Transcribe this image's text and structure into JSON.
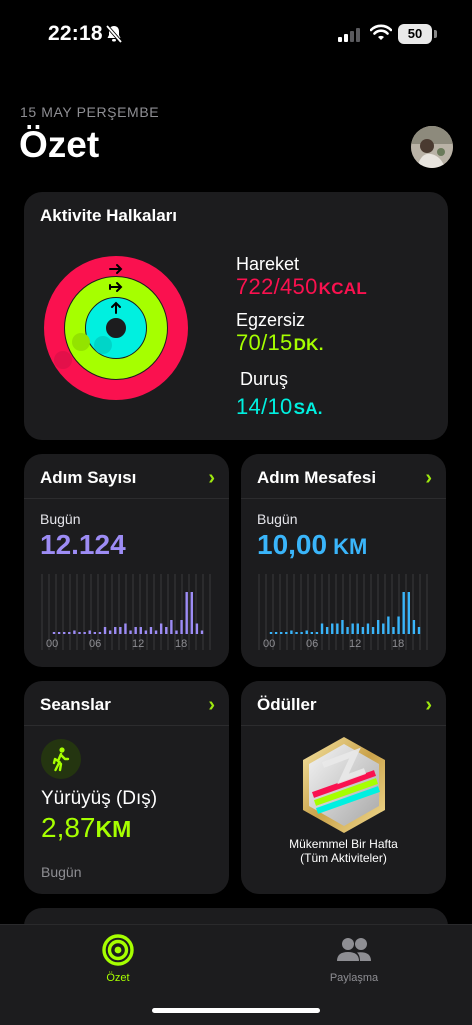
{
  "status": {
    "time": "22:18",
    "battery": "50"
  },
  "header": {
    "date": "15 MAY PERŞEMBE",
    "title": "Özet"
  },
  "activity": {
    "title": "Aktivite Halkaları",
    "move": {
      "label": "Hareket",
      "value": "722/450",
      "unit": "KCAL",
      "progress": 1.6,
      "color": "#fa114f"
    },
    "exercise": {
      "label": "Egzersiz",
      "value": "70/15",
      "unit": "DK.",
      "progress": 4.67,
      "color": "#a6ff00"
    },
    "stand": {
      "label": "Duruş",
      "value": "14/10",
      "unit": "SA.",
      "progress": 1.4,
      "color": "#00f0e0"
    }
  },
  "steps": {
    "title": "Adım Sayısı",
    "today_label": "Bugün",
    "value": "12.124",
    "color": "#9d8cf5",
    "hours": [
      0,
      0,
      0,
      0,
      1,
      0,
      0,
      1,
      0,
      0,
      2,
      1,
      2,
      2,
      3,
      1,
      2,
      2,
      1,
      2,
      1,
      3,
      2,
      4,
      1,
      4,
      12,
      12,
      3,
      1
    ],
    "axis": [
      "00",
      "06",
      "12",
      "18"
    ]
  },
  "distance": {
    "title": "Adım Mesafesi",
    "today_label": "Bugün",
    "value": "10,00",
    "unit": "KM",
    "color": "#3ab5fa",
    "hours": [
      0,
      0,
      0,
      0,
      1,
      0,
      0,
      1,
      0,
      0,
      3,
      2,
      3,
      3,
      4,
      2,
      3,
      3,
      2,
      3,
      2,
      4,
      3,
      5,
      2,
      5,
      12,
      12,
      4,
      2
    ],
    "axis": [
      "00",
      "06",
      "12",
      "18"
    ]
  },
  "sessions": {
    "title": "Seanslar",
    "activity_name": "Yürüyüş (Dış)",
    "value": "2,87",
    "unit": "KM",
    "when": "Bugün",
    "color": "#a6ff00"
  },
  "awards": {
    "title": "Ödüller",
    "award_name_line1": "Mükemmel Bir Hafta",
    "award_name_line2": "(Tüm Aktiviteler)"
  },
  "tabs": {
    "summary": "Özet",
    "sharing": "Paylaşma"
  }
}
